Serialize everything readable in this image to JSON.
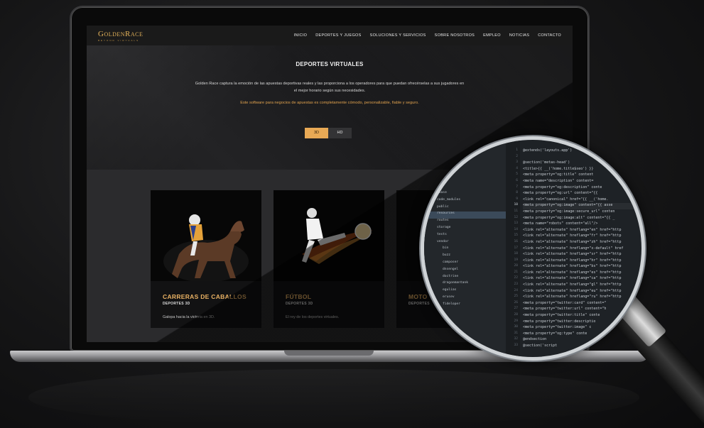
{
  "site": {
    "logo_text": "GoldenRace",
    "logo_tagline": "BEYOND VIRTUALS",
    "nav": [
      "INICIO",
      "DEPORTES Y JUEGOS",
      "SOLUCIONES Y SERVICIOS",
      "SOBRE NOSOTROS",
      "EMPLEO",
      "NOTICIAS",
      "CONTACTO"
    ],
    "hero_title": "DEPORTES VIRTUALES",
    "hero_desc": "Golden Race captura la emoción de las apuestas deportivas reales y las proporciona a los operadores para que puedan ofrecérselas a sus jugadores en el mejor horario según sus necesidades.",
    "hero_highlight": "Este software para negocios de apuestas es completamente cómodo, personalizable, fiable y seguro.",
    "toggle": {
      "active": "3D",
      "inactive": "HD"
    },
    "cards": [
      {
        "title": "CARRERAS DE CABALLOS",
        "subtitle": "DEPORTES 3D",
        "desc": "Galopa hacia la victoria en 3D."
      },
      {
        "title": "FÚTBOL",
        "subtitle": "DEPORTES 3D",
        "desc": "El rey de los deportes virtuales."
      },
      {
        "title": "MOTO",
        "subtitle": "DEPORTES",
        "desc": ""
      }
    ]
  },
  "editor": {
    "tree": [
      "abase",
      "code_modules",
      "public",
      "resources",
      "routes",
      "storage",
      "tests",
      "vendor",
      "bin",
      "buzz",
      "composer",
      "dnsengel",
      "doctrine",
      "dragonmantank",
      "egulias",
      "erusev",
      "fideloper"
    ],
    "selected_index": 3,
    "line_numbers": [
      "1",
      "2",
      "3",
      "4",
      "5",
      "6",
      "7",
      "8",
      "9",
      "10",
      "11",
      "12",
      "13",
      "14",
      "15",
      "16",
      "17",
      "18",
      "19",
      "20",
      "21",
      "22",
      "23",
      "24",
      "25",
      "26",
      "27",
      "28",
      "29",
      "30",
      "31",
      "32",
      "33"
    ],
    "highlighted_line": 10,
    "code_lines": [
      "@extends('layouts.app')",
      "",
      "@section('metas-head')",
      "    <title>{{ __('home.title$seo') }}",
      "    <meta property=\"og:title\" content",
      "    <meta name=\"description\" content=",
      "    <meta property=\"og:description\" conte",
      "    <meta property=\"og:url\" content=\"{{",
      "    <link rel=\"canonical\" href=\"{{ __('home.",
      "    <meta property=\"og:image\" content=\"{{ asse",
      "    <meta property=\"og:image:secure_url\" conten",
      "    <meta property=\"og:image:alt\" content=\"{{ _",
      "    <meta name=\"robots\" content=\"all\"/>",
      "    <link rel=\"alternate\" hreflang=\"en\" href=\"http",
      "    <link rel=\"alternate\" hreflang=\"fr\" href=\"http",
      "    <link rel=\"alternate\" hreflang=\"zh\" href=\"http",
      "    <link rel=\"alternate\" hreflang=\"x-default\" href",
      "    <link rel=\"alternate\" hreflang=\"sr\" href=\"http",
      "    <link rel=\"alternate\" hreflang=\"hr\" href=\"http",
      "    <link rel=\"alternate\" hreflang=\"bs\" href=\"http",
      "    <link rel=\"alternate\" hreflang=\"es\" href=\"http",
      "    <link rel=\"alternate\" hreflang=\"ca\" href=\"http",
      "    <link rel=\"alternate\" hreflang=\"gl\" href=\"http",
      "    <link rel=\"alternate\" hreflang=\"eu\" href=\"http",
      "    <link rel=\"alternate\" hreflang=\"ru\" href=\"http",
      "    <meta property=\"twitter:card\" content=\"",
      "    <meta property=\"twitter:url\" content=\"h",
      "    <meta property=\"twitter:title\" conte",
      "    <meta property=\"twitter:descriptio",
      "    <meta property=\"twitter:image\" c",
      "    <meta property=\"og:type\" conte",
      "@endsection",
      "@section('script"
    ]
  },
  "colors": {
    "accent": "#e9b163",
    "highlight": "#e0a24e",
    "nav_bg": "#1a1a1a",
    "card_bg": "#121213"
  }
}
